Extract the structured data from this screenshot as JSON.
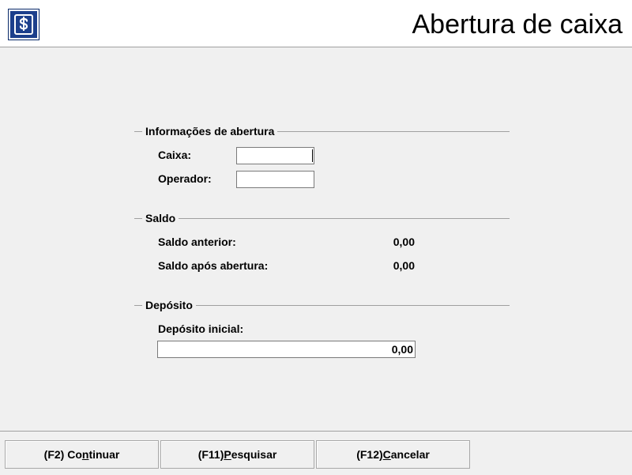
{
  "window": {
    "title": "Abertura de caixa",
    "icon": "dollar-sign-icon",
    "accent_color": "#1c3f8c"
  },
  "sections": {
    "info": {
      "title": "Informações de abertura",
      "caixa_label": "Caixa:",
      "caixa_value": "",
      "operador_label": "Operador:",
      "operador_value": ""
    },
    "saldo": {
      "title": "Saldo",
      "anterior_label": "Saldo anterior:",
      "anterior_value": "0,00",
      "apos_label": "Saldo após abertura:",
      "apos_value": "0,00"
    },
    "deposito": {
      "title": "Depósito",
      "inicial_label": "Depósito inicial:",
      "inicial_value": "0,00"
    }
  },
  "buttons": {
    "continuar": {
      "prefix": "(F2) Co",
      "mnemonic": "n",
      "suffix": "tinuar"
    },
    "pesquisar": {
      "prefix": "(F11) ",
      "mnemonic": "P",
      "suffix": "esquisar"
    },
    "cancelar": {
      "prefix": "(F12) ",
      "mnemonic": "C",
      "suffix": "ancelar"
    }
  }
}
